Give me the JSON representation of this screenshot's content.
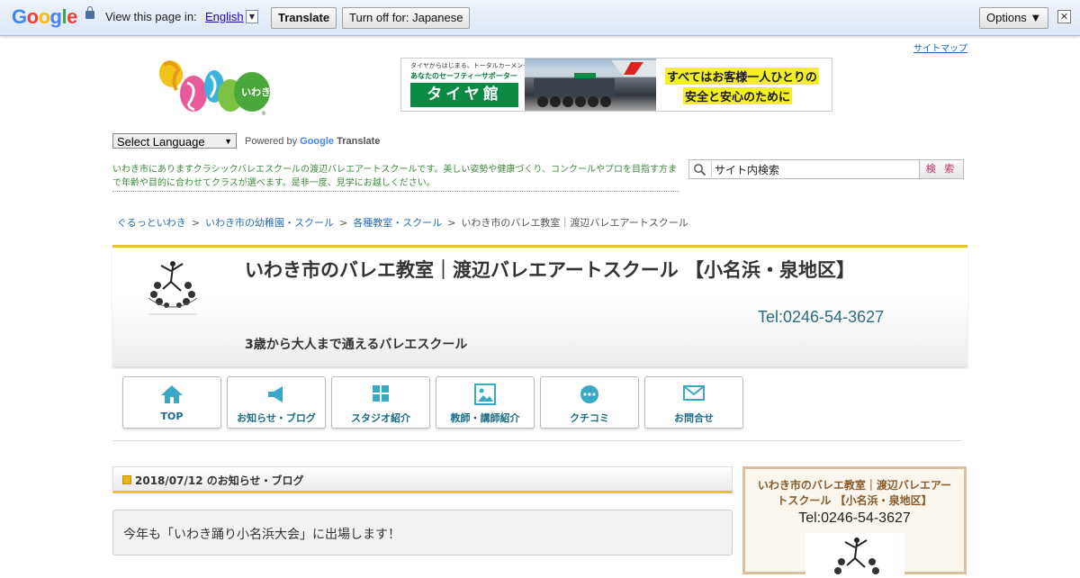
{
  "google_bar": {
    "logo": [
      "G",
      "o",
      "o",
      "g",
      "l",
      "e"
    ],
    "view_text": "View this page in:",
    "language": "English",
    "translate_button": "Translate",
    "turn_off_button": "Turn off for: Japanese",
    "options_button": "Options ▼",
    "close": "✕"
  },
  "header": {
    "sitemap_link": "サイトマップ",
    "banner": {
      "small_text": "タイヤからはじまる、トータルカーメンテナンス",
      "supporter": "あなたのセーフティーサポーター",
      "brand": "タイヤ館",
      "line1": "すべてはお客様一人ひとりの",
      "line2": "安全と安心のために"
    },
    "language_select": "Select Language",
    "powered_by": "Powered by",
    "google_word": "Google",
    "translate_word": "Translate",
    "intro_text": "いわき市にありますクラシックバレエスクールの渡辺バレエアートスクールです。美しい姿勢や健康づくり、コンクールやプロを目指す方まで年齢や目的に合わせてクラスが選べます。是非一度、見学にお越しください。",
    "search": {
      "value": "サイト内検索",
      "button": "検 索"
    }
  },
  "breadcrumb": [
    "ぐるっといわき",
    "いわき市の幼稚園・スクール",
    "各種教室・スクール",
    "いわき市のバレエ教室｜渡辺バレエアートスクール"
  ],
  "breadcrumb_sep": ">",
  "title_block": {
    "title": "いわき市のバレエ教室｜渡辺バレエアートスクール 【小名浜・泉地区】",
    "tel": "Tel:0246-54-3627",
    "subtitle": "3歳から大人まで通えるバレエスクール"
  },
  "nav": [
    {
      "label": "TOP",
      "icon": "home-icon"
    },
    {
      "label": "お知らせ・ブログ",
      "icon": "megaphone-icon"
    },
    {
      "label": "スタジオ紹介",
      "icon": "grid-icon"
    },
    {
      "label": "教師・講師紹介",
      "icon": "picture-icon"
    },
    {
      "label": "クチコミ",
      "icon": "chat-icon"
    },
    {
      "label": "お問合せ",
      "icon": "mail-icon"
    }
  ],
  "main": {
    "post_header": "2018/07/12 のお知らせ・ブログ",
    "post_title": "今年も「いわき踊り小名浜大会」に出場します！"
  },
  "side": {
    "name": "いわき市のバレエ教室｜渡辺バレエアートスクール 【小名浜・泉地区】",
    "tel": "Tel:0246-54-3627"
  },
  "colors": {
    "accent_gold": "#e6c12e",
    "nav_teal": "#1d6b86",
    "intro_green": "#3a8a3a"
  }
}
